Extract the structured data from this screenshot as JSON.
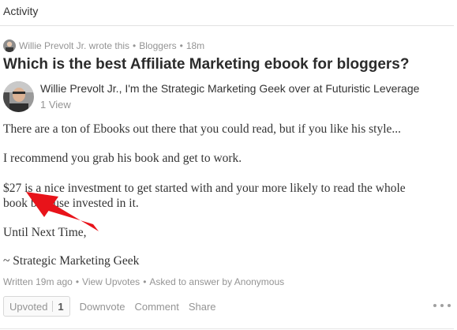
{
  "section": {
    "title": "Activity"
  },
  "meta": {
    "actor_action": "Willie Prevolt Jr. wrote this",
    "topic": "Bloggers",
    "time": "18m"
  },
  "question": {
    "title": "Which is the best Affiliate Marketing ebook for bloggers?"
  },
  "author": {
    "credential": "Willie Prevolt Jr., I'm the Strategic Marketing Geek over at Futuristic Leverage",
    "views": "1 View"
  },
  "answer": {
    "p1": "There are a ton of Ebooks out there that you could read, but if you like his style...",
    "p2": "I recommend you grab his book and get to work.",
    "p3_line1": "$27 is a nice investment to get started with and your more likely to read the whole",
    "p3_line2": "book because invested in it.",
    "p4": "Until Next Time,",
    "p5": "~ Strategic Marketing Geek"
  },
  "footer": {
    "written": "Written 19m ago",
    "view_upvotes": "View Upvotes",
    "asked": "Asked to answer by Anonymous"
  },
  "actions": {
    "upvoted_label": "Upvoted",
    "upvote_count": "1",
    "downvote": "Downvote",
    "comment": "Comment",
    "share": "Share"
  },
  "colors": {
    "arrow": "#e8131a",
    "muted_text": "#949494",
    "body_text": "#333333"
  },
  "icons": [
    "user-avatar-icon",
    "author-avatar-icon",
    "more-options-icon",
    "red-arrow-annotation"
  ]
}
